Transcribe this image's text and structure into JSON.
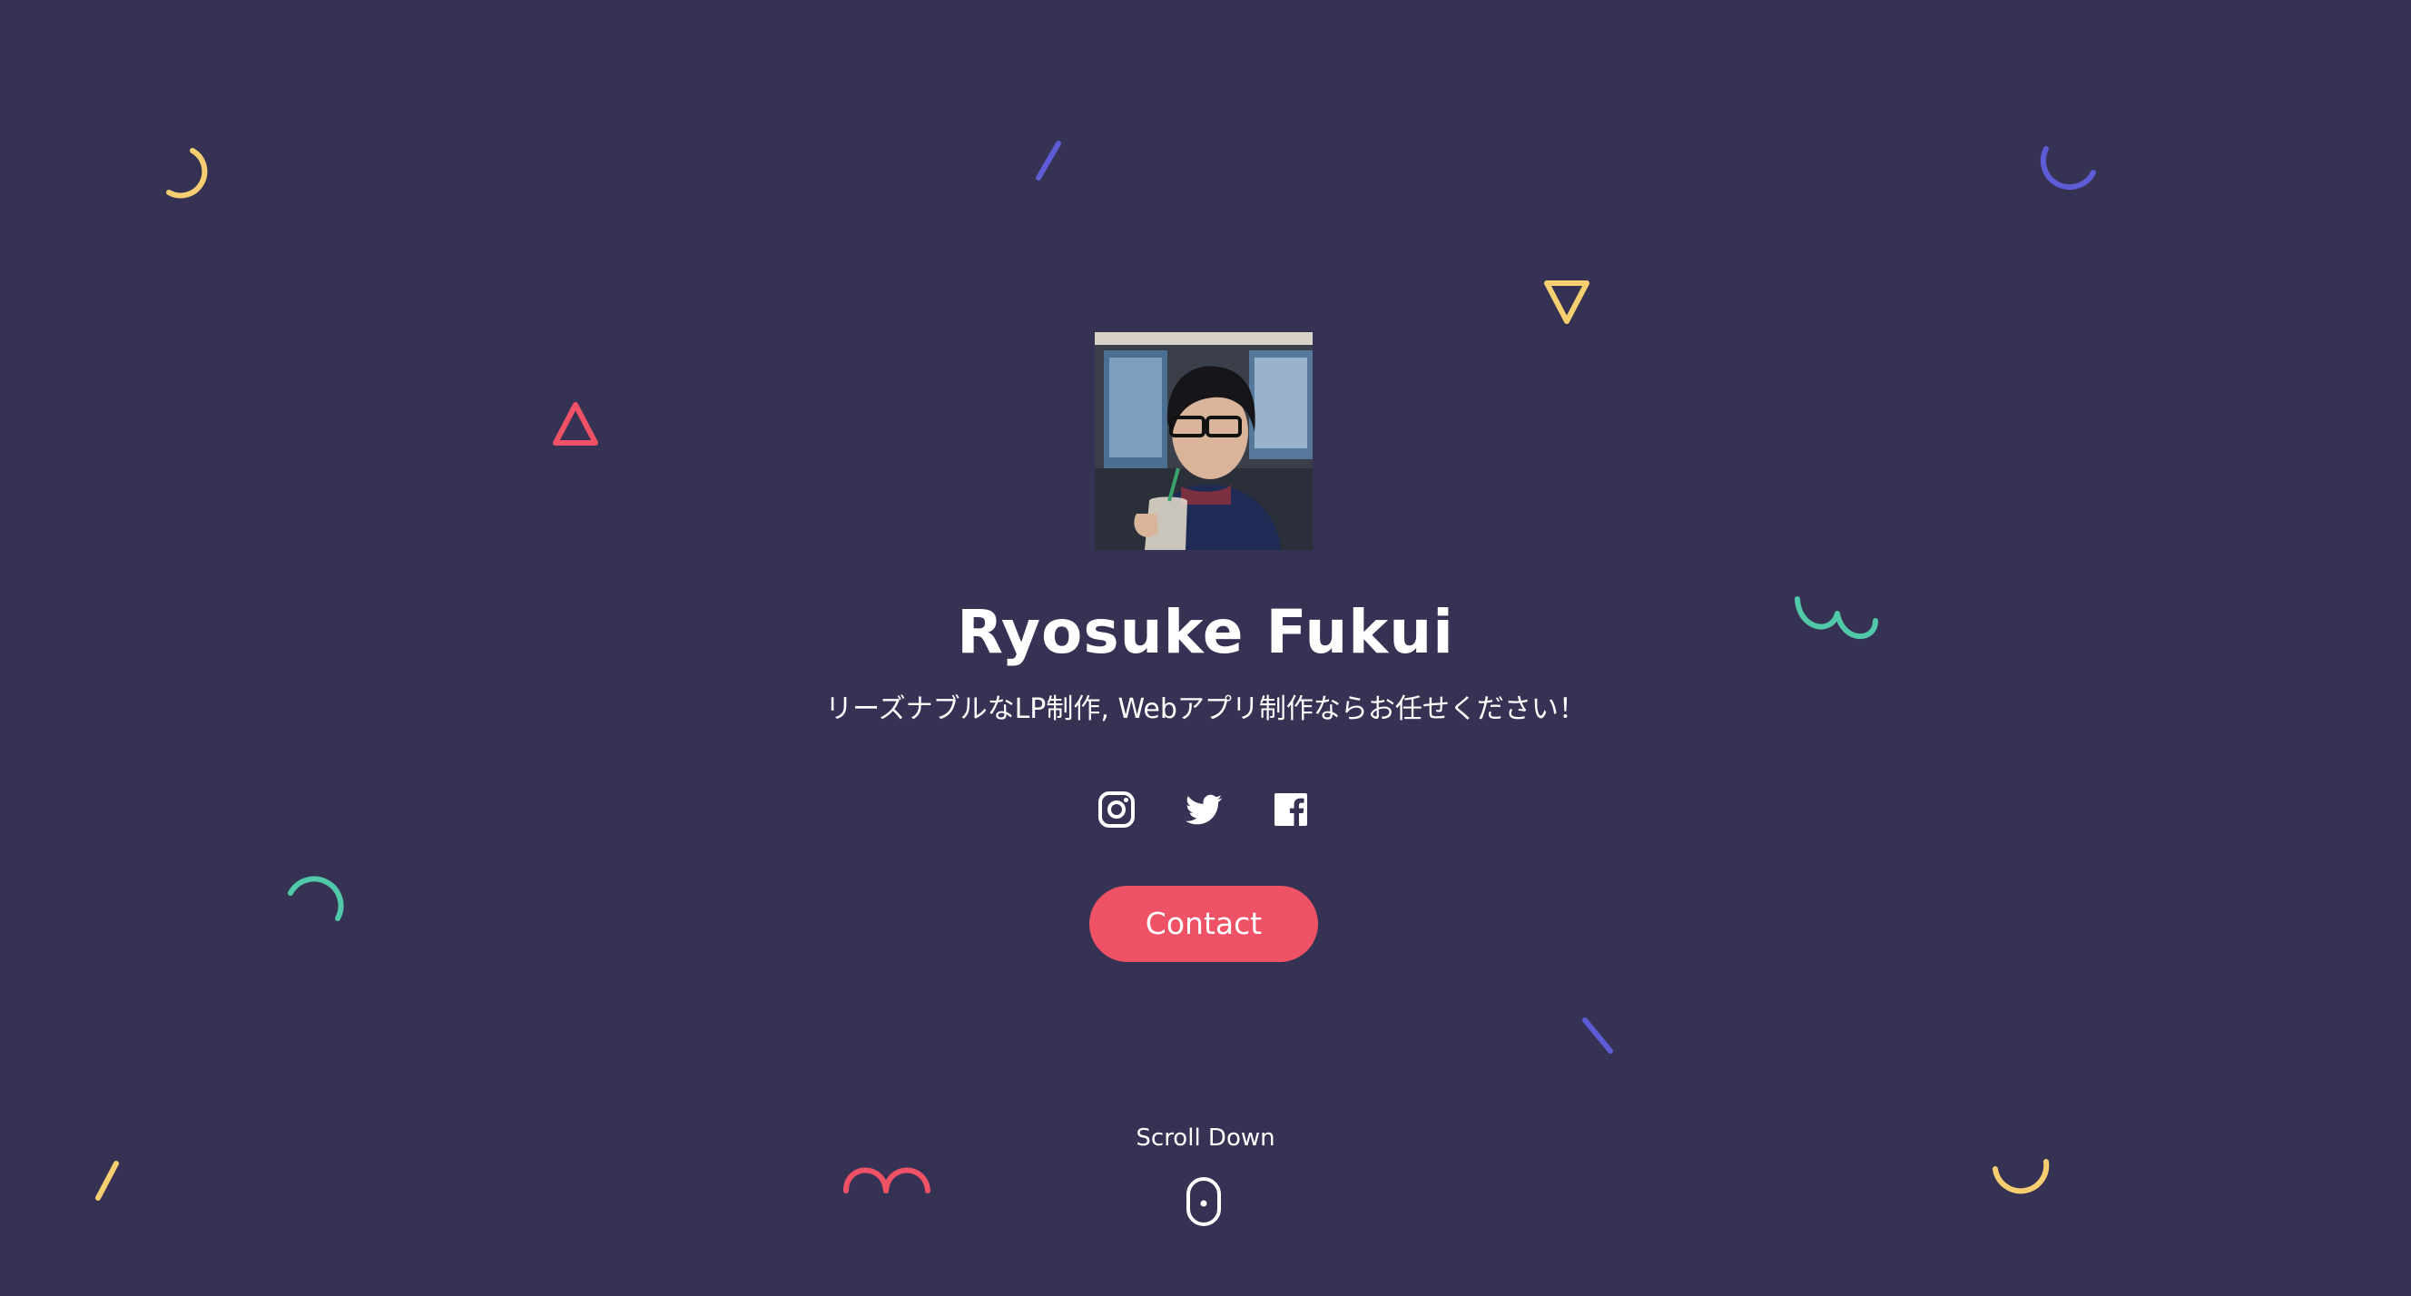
{
  "hero": {
    "name": "Ryosuke Fukui",
    "tagline": "リーズナブルなLP制作, Webアプリ制作ならお任せください！",
    "contact_label": "Contact",
    "scroll_label": "Scroll Down"
  },
  "social": [
    {
      "icon": "instagram-icon"
    },
    {
      "icon": "twitter-icon"
    },
    {
      "icon": "facebook-icon"
    }
  ],
  "colors": {
    "background": "#363253",
    "accent": "#ef5266",
    "yellow": "#f7cf71",
    "purple": "#5e5bd6",
    "teal": "#51c8a8",
    "text": "#ffffff"
  }
}
